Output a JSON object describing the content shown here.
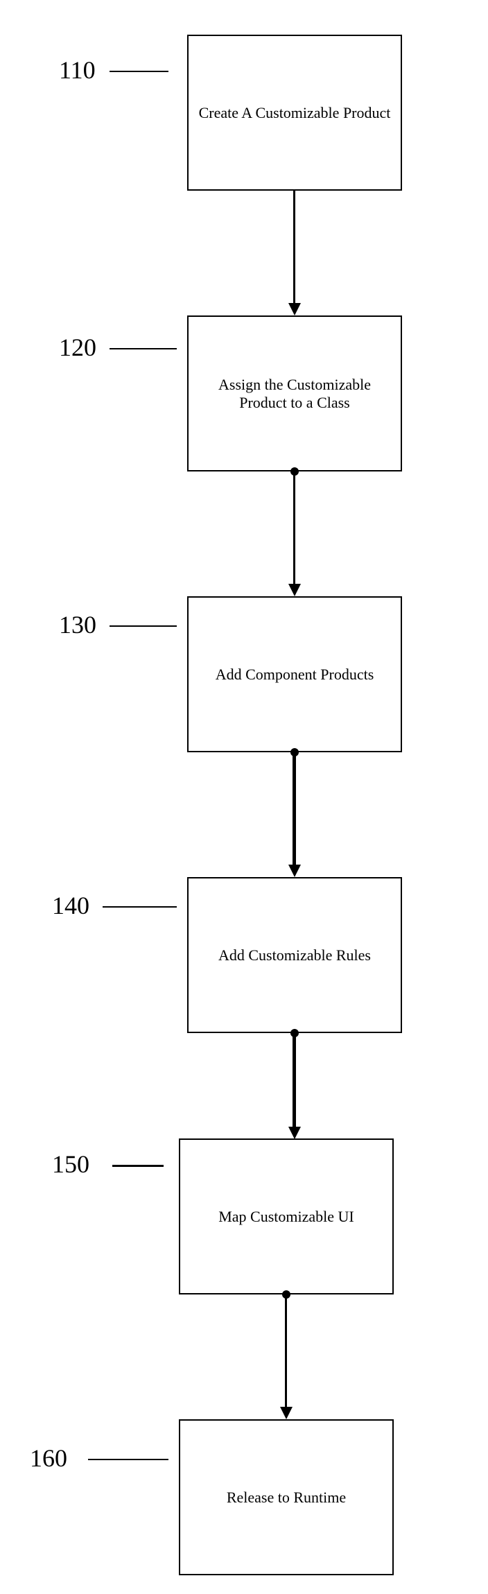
{
  "diagram": {
    "type": "flowchart",
    "steps": [
      {
        "id": "110",
        "label": "Create A Customizable Product"
      },
      {
        "id": "120",
        "label": "Assign the Customizable Product to a Class"
      },
      {
        "id": "130",
        "label": "Add Component Products"
      },
      {
        "id": "140",
        "label": "Add Customizable Rules"
      },
      {
        "id": "150",
        "label": "Map Customizable UI"
      },
      {
        "id": "160",
        "label": "Release to Runtime"
      }
    ]
  }
}
